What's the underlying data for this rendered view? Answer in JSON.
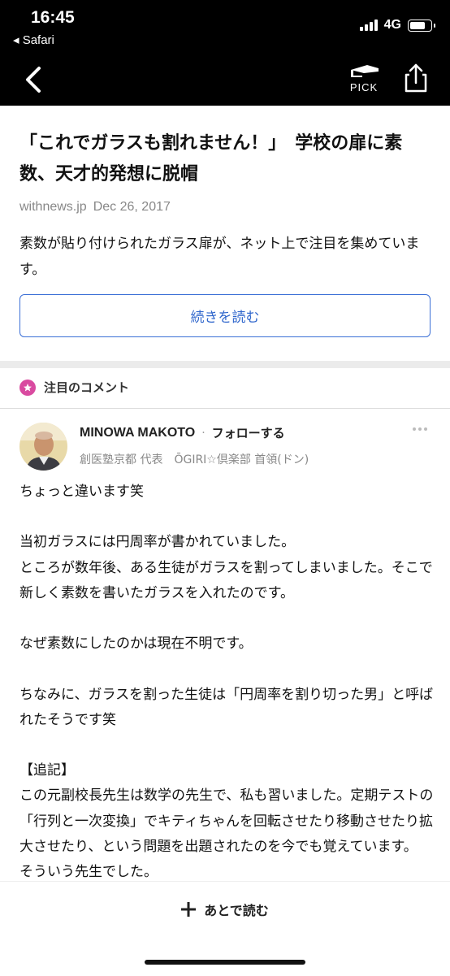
{
  "status_bar": {
    "time": "16:45",
    "back_app": "◂ Safari",
    "network": "4G",
    "battery_level": 0.8
  },
  "nav": {
    "back_icon": "chevron-left-icon",
    "pick_label": "PICK",
    "share_icon": "share-icon"
  },
  "article": {
    "title": "「これでガラスも割れません！」　学校の扉に素数、天才的発想に脱帽",
    "source": "withnews.jp",
    "date": "Dec 26, 2017",
    "summary": "素数が貼り付けられたガラス扉が、ネット上で注目を集めています。",
    "read_more_label": "続きを読む"
  },
  "comments_section": {
    "title": "注目のコメント",
    "badge_icon": "star-icon",
    "badge_color": "#d94aa0"
  },
  "comment": {
    "author": "MINOWA MAKOTO",
    "separator": "·",
    "follow_label": "フォローする",
    "author_title": "創医塾京都 代表　ŌGIRI☆倶楽部 首領(ドン)",
    "paragraphs": [
      "ちょっと違います笑",
      "当初ガラスには円周率が書かれていました。\nところが数年後、ある生徒がガラスを割ってしまいました。そこで新しく素数を書いたガラスを入れたのです。",
      "なぜ素数にしたのかは現在不明です。",
      "ちなみに、ガラスを割った生徒は「円周率を割り切った男」と呼ばれたそうです笑",
      "【追記】\nこの元副校長先生は数学の先生で、私も習いました。定期テストの「行列と一次変換」でキティちゃんを回転させたり移動させたり拡大させたり、という問題を出題されたのを今でも覚えています。\nそういう先生でした。"
    ]
  },
  "bottom": {
    "read_later_label": "あとで読む",
    "read_later_icon": "plus-icon"
  },
  "colors": {
    "accent_blue": "#2f66cc",
    "topbar": "#000000"
  }
}
